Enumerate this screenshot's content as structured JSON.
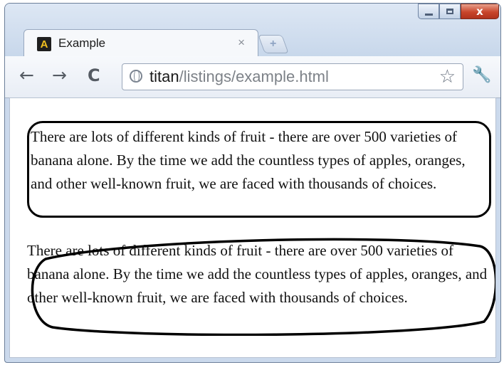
{
  "window": {
    "controls": {
      "minimize": "",
      "maximize": "",
      "close": "x"
    }
  },
  "tab": {
    "favicon_letter": "A",
    "title": "Example",
    "close_glyph": "×",
    "new_tab_glyph": "+"
  },
  "toolbar": {
    "back_glyph": "←",
    "forward_glyph": "→",
    "reload_glyph": "C",
    "url_host": "titan",
    "url_path": "/listings/example.html",
    "star_glyph": "☆",
    "wrench_glyph": "🔧"
  },
  "content": {
    "paragraph_1": "There are lots of different kinds of fruit - there are over 500 varieties of banana alone. By the time we add the countless types of apples, oranges, and other well-known fruit, we are faced with thousands of choices.",
    "paragraph_2": "There are lots of different kinds of fruit - there are over 500 varieties of banana alone. By the time we add the countless types of apples, oranges, and other well-known fruit, we are faced with thousands of choices."
  },
  "colors": {
    "chrome_frame": "#cbd9ec",
    "close_button": "#c8452b",
    "border": "#000000"
  }
}
